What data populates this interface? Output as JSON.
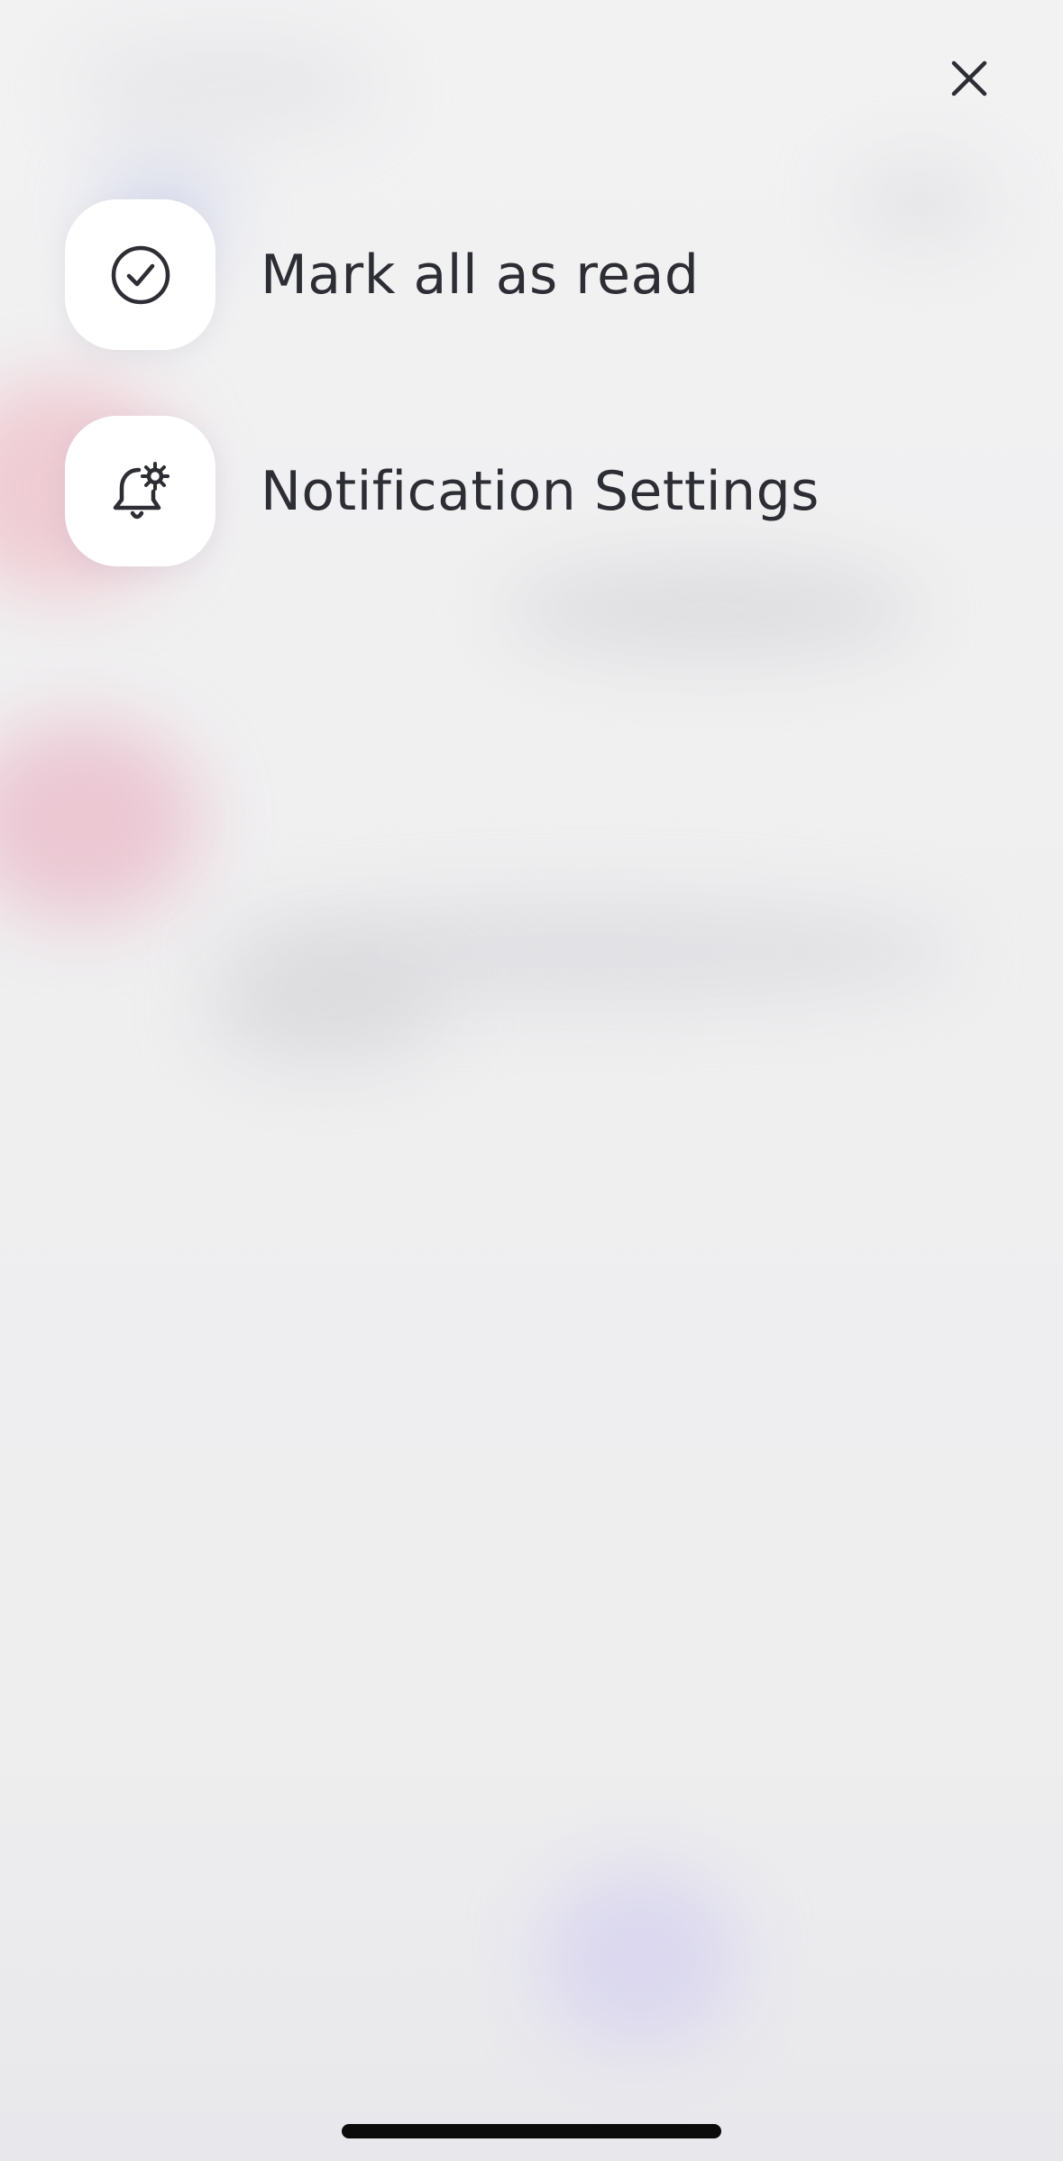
{
  "close": {
    "icon": "close-icon"
  },
  "menu": {
    "items": [
      {
        "label": "Mark all as read",
        "icon": "check-circle-icon"
      },
      {
        "label": "Notification Settings",
        "icon": "bell-settings-icon"
      }
    ]
  },
  "colors": {
    "text": "#2d2d34",
    "tile": "#ffffff",
    "backdrop": "#efeff1"
  }
}
